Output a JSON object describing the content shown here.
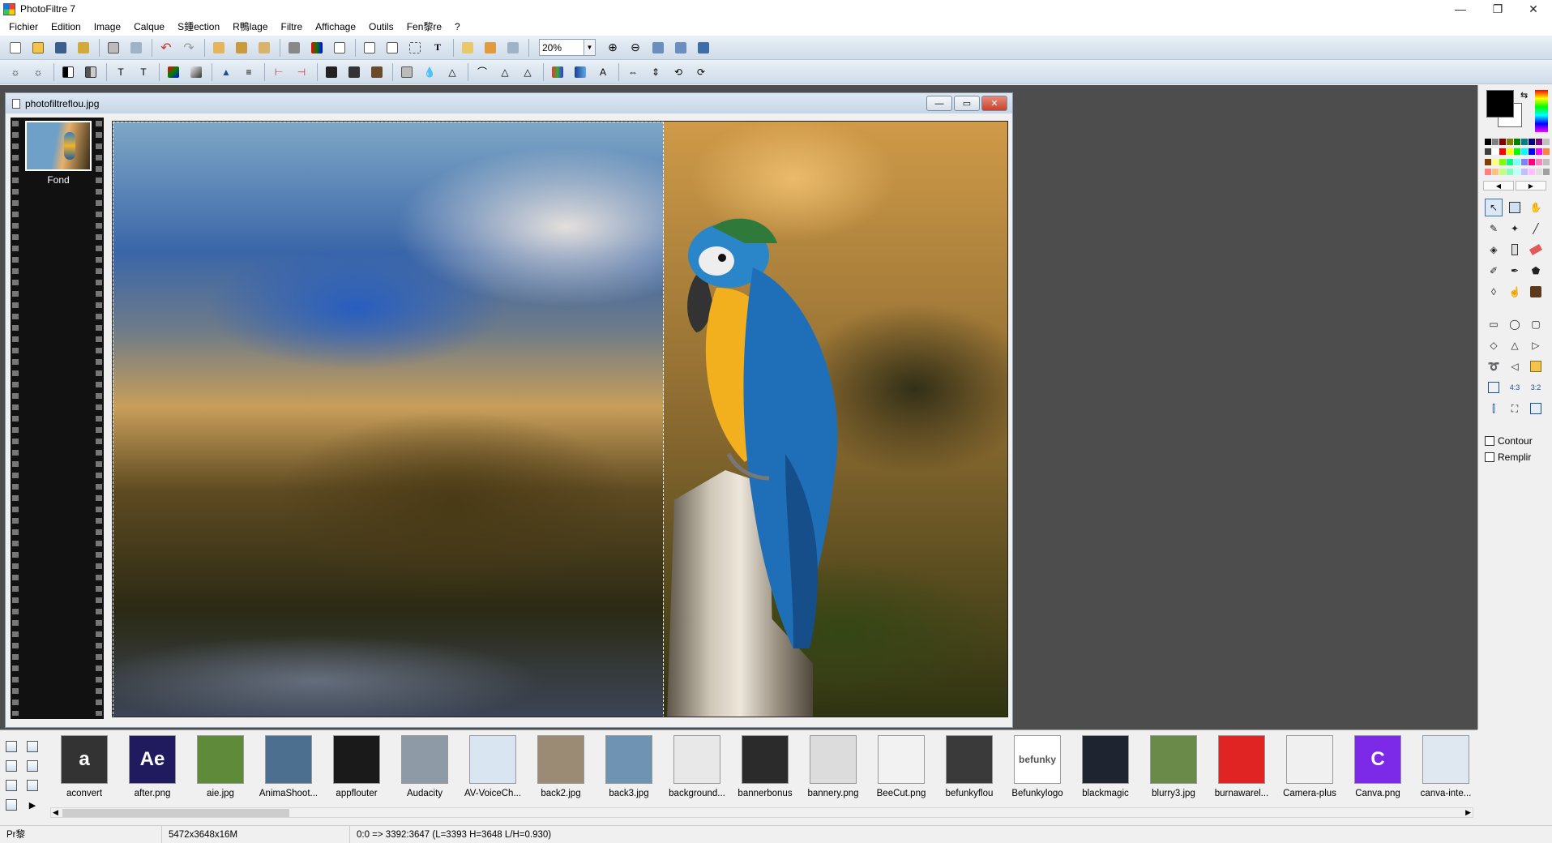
{
  "app": {
    "title": "PhotoFiltre 7",
    "minimize": "—",
    "maximize": "❐",
    "close": "✕"
  },
  "menu": [
    "Fichier",
    "Edition",
    "Image",
    "Calque",
    "S鍾ection",
    "R鴨lage",
    "Filtre",
    "Affichage",
    "Outils",
    "Fen黎re",
    "?"
  ],
  "toolbar1": {
    "zoom_value": "20%"
  },
  "document": {
    "title": "photofiltreflou.jpg",
    "layer_name": "Fond"
  },
  "palette": {
    "foreground": "#000000",
    "background": "#ffffff",
    "colors": [
      "#000000",
      "#808080",
      "#800000",
      "#808000",
      "#008000",
      "#008080",
      "#000080",
      "#800080",
      "#c0c0c0",
      "#404040",
      "#ffffff",
      "#ff0000",
      "#ffff00",
      "#00ff00",
      "#00ffff",
      "#0000ff",
      "#ff00ff",
      "#ff8040",
      "#804000",
      "#ffff80",
      "#80ff00",
      "#00ff80",
      "#80ffff",
      "#8080ff",
      "#ff0080",
      "#ff80c0",
      "#c0c0c0",
      "#ff8080",
      "#ffc080",
      "#c0ff80",
      "#80ffc0",
      "#c0ffff",
      "#c0c0ff",
      "#ffc0ff",
      "#e0e0e0",
      "#a0a0a0"
    ]
  },
  "options": {
    "contour": "Contour",
    "remplir": "Remplir"
  },
  "filmstrip": {
    "items": [
      {
        "name": "aconvert",
        "thumb": "a",
        "color": "#333333"
      },
      {
        "name": "after.png",
        "thumb": "Ae",
        "color": "#1f1b5e"
      },
      {
        "name": "aie.jpg",
        "thumb": "",
        "color": "#5f8a3a"
      },
      {
        "name": "AnimaShoot...",
        "thumb": "",
        "color": "#4d6f8f"
      },
      {
        "name": "appflouter",
        "thumb": "",
        "color": "#1a1a1a"
      },
      {
        "name": "Audacity",
        "thumb": "",
        "color": "#8e9aa6"
      },
      {
        "name": "AV-VoiceCh...",
        "thumb": "",
        "color": "#d9e6f2"
      },
      {
        "name": "back2.jpg",
        "thumb": "",
        "color": "#9b8a74"
      },
      {
        "name": "back3.jpg",
        "thumb": "",
        "color": "#6f93b3"
      },
      {
        "name": "background...",
        "thumb": "",
        "color": "#e8e8e8"
      },
      {
        "name": "bannerbonus",
        "thumb": "",
        "color": "#2b2b2b"
      },
      {
        "name": "bannery.png",
        "thumb": "",
        "color": "#dcdcdc"
      },
      {
        "name": "BeeCut.png",
        "thumb": "",
        "color": "#f2f2f2"
      },
      {
        "name": "befunkyflou",
        "thumb": "",
        "color": "#3a3a3a"
      },
      {
        "name": "Befunkylogo",
        "thumb": "befunky",
        "color": "#ffffff"
      },
      {
        "name": "blackmagic",
        "thumb": "",
        "color": "#1e2430"
      },
      {
        "name": "blurry3.jpg",
        "thumb": "",
        "color": "#6a8a4a"
      },
      {
        "name": "burnawarel...",
        "thumb": "",
        "color": "#e02424"
      },
      {
        "name": "Camera-plus",
        "thumb": "",
        "color": "#f0f0f0"
      },
      {
        "name": "Canva.png",
        "thumb": "C",
        "color": "#7d2ae8"
      },
      {
        "name": "canva-inte...",
        "thumb": "",
        "color": "#dfe8f0"
      }
    ]
  },
  "status": {
    "mode": "Pr黎",
    "size": "5472x3648x16M",
    "coords": "0:0 => 3392:3647 (L=3393  H=3648  L/H=0.930)"
  }
}
